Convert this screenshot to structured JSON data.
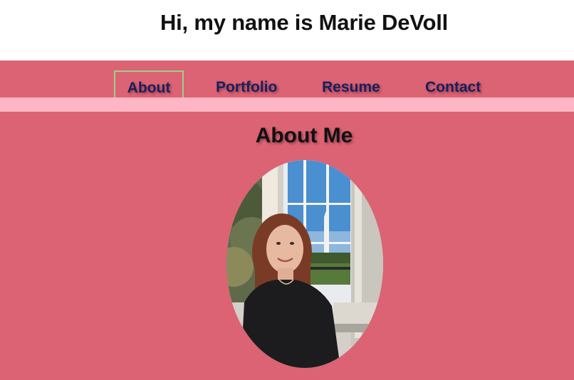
{
  "header": {
    "title": "Hi, my name is Marie DeVoll"
  },
  "nav": {
    "items": [
      {
        "label": "About",
        "active": true
      },
      {
        "label": "Portfolio",
        "active": false
      },
      {
        "label": "Resume",
        "active": false
      },
      {
        "label": "Contact",
        "active": false
      }
    ]
  },
  "main": {
    "section_title": "About Me",
    "photo_alt": "Photo of Marie DeVoll"
  },
  "colors": {
    "page_background": "#dc6373",
    "header_background": "#ffffff",
    "nav_strip": "#ffb6c4",
    "nav_text": "#1a1f5c",
    "active_border": "#9fd08a"
  }
}
